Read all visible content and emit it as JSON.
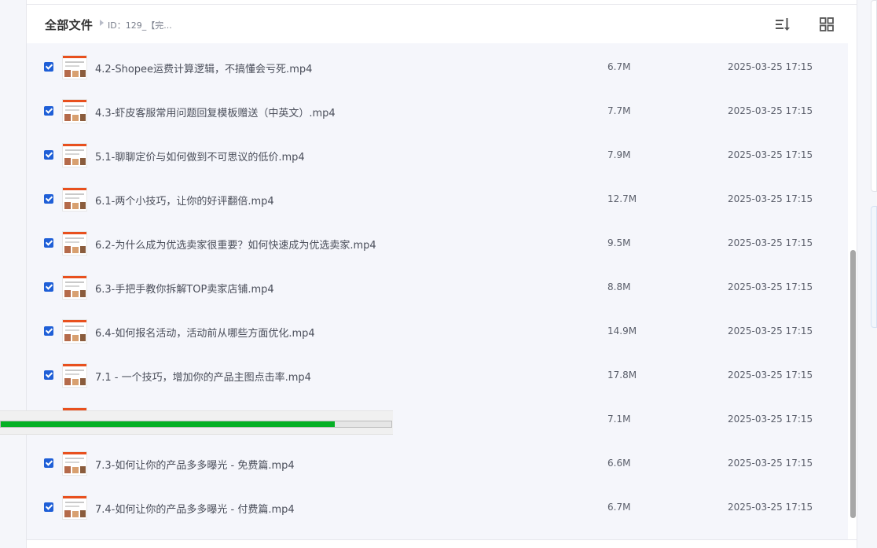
{
  "header": {
    "root_label": "全部文件",
    "current_folder": "ID：129_【完..."
  },
  "files": [
    {
      "name": "4.2-Shopee运费计算逻辑，不搞懂会亏死.mp4",
      "size": "6.7M",
      "date": "2025-03-25 17:15",
      "checked": true
    },
    {
      "name": "4.3-虾皮客服常用问题回复模板赠送（中英文）.mp4",
      "size": "7.7M",
      "date": "2025-03-25 17:15",
      "checked": true
    },
    {
      "name": "5.1-聊聊定价与如何做到不可思议的低价.mp4",
      "size": "7.9M",
      "date": "2025-03-25 17:15",
      "checked": true
    },
    {
      "name": "6.1-两个小技巧，让你的好评翻倍.mp4",
      "size": "12.7M",
      "date": "2025-03-25 17:15",
      "checked": true
    },
    {
      "name": "6.2-为什么成为优选卖家很重要？如何快速成为优选卖家.mp4",
      "size": "9.5M",
      "date": "2025-03-25 17:15",
      "checked": true
    },
    {
      "name": "6.3-手把手教你拆解TOP卖家店铺.mp4",
      "size": "8.8M",
      "date": "2025-03-25 17:15",
      "checked": true
    },
    {
      "name": "6.4-如何报名活动，活动前从哪些方面优化.mp4",
      "size": "14.9M",
      "date": "2025-03-25 17:15",
      "checked": true
    },
    {
      "name": "7.1 - 一个技巧，增加你的产品主图点击率.mp4",
      "size": "17.8M",
      "date": "2025-03-25 17:15",
      "checked": true
    },
    {
      "name": "",
      "size": "7.1M",
      "date": "2025-03-25 17:15",
      "checked": true
    },
    {
      "name": "7.3-如何让你的产品多多曝光 - 免费篇.mp4",
      "size": "6.6M",
      "date": "2025-03-25 17:15",
      "checked": true
    },
    {
      "name": "7.4-如何让你的产品多多曝光 - 付费篇.mp4",
      "size": "6.7M",
      "date": "2025-03-25 17:15",
      "checked": true
    }
  ],
  "progress": {
    "fraction": 0.855
  },
  "colors": {
    "accent": "#1f5fd7",
    "progress": "#06b025"
  },
  "icons": {
    "sort": "sort-list-icon",
    "view": "grid-view-icon"
  }
}
